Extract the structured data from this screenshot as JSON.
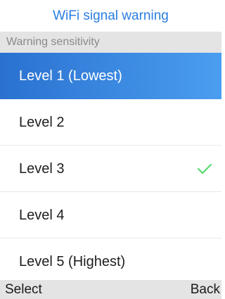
{
  "title": "WiFi signal warning",
  "section_header": "Warning sensitivity",
  "options": [
    {
      "label": "Level 1 (Lowest)",
      "highlighted": true,
      "checked": false
    },
    {
      "label": "Level 2",
      "highlighted": false,
      "checked": false
    },
    {
      "label": "Level 3",
      "highlighted": false,
      "checked": true
    },
    {
      "label": "Level 4",
      "highlighted": false,
      "checked": false
    },
    {
      "label": "Level 5 (Highest)",
      "highlighted": false,
      "checked": false
    }
  ],
  "softkeys": {
    "left": "Select",
    "right": "Back"
  },
  "icons": {
    "check": "checkmark-icon"
  },
  "colors": {
    "accent": "#2a7de1",
    "highlight_start": "#2a71d0",
    "highlight_end": "#4a9ef0",
    "check": "#4cd964",
    "header_bg": "#e4e4e4"
  }
}
